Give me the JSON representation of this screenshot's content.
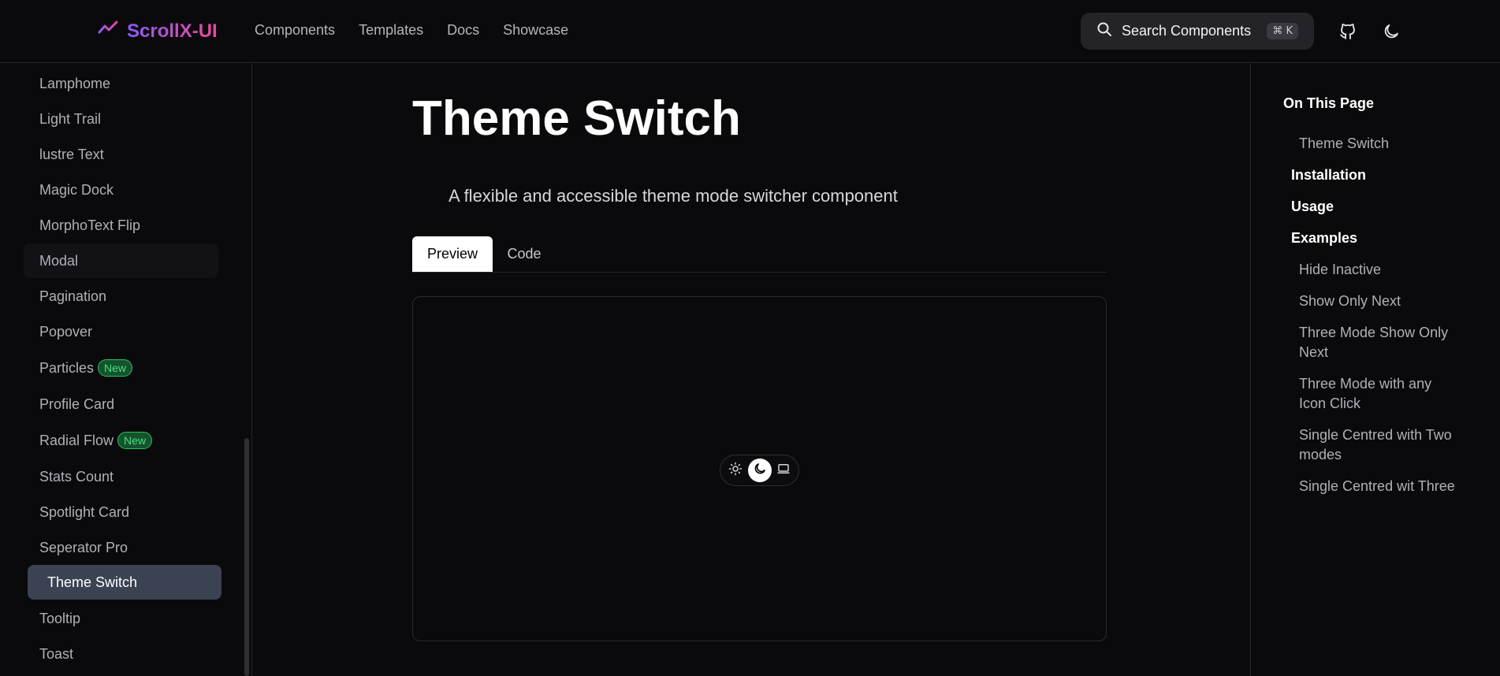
{
  "header": {
    "logo_text": "ScrollX-UI",
    "nav": [
      "Components",
      "Templates",
      "Docs",
      "Showcase"
    ],
    "search_label": "Search Components",
    "search_shortcut": "⌘ K",
    "icons": [
      "logo-chart-icon",
      "search-icon",
      "github-icon",
      "moon-icon"
    ]
  },
  "sidebar": {
    "items": [
      {
        "label": "Lamphome"
      },
      {
        "label": "Light Trail"
      },
      {
        "label": "lustre Text"
      },
      {
        "label": "Magic Dock"
      },
      {
        "label": "MorphoText Flip"
      },
      {
        "label": "Modal"
      },
      {
        "label": "Pagination"
      },
      {
        "label": "Popover"
      },
      {
        "label": "Particles",
        "badge": "New"
      },
      {
        "label": "Profile Card"
      },
      {
        "label": "Radial Flow",
        "badge": "New"
      },
      {
        "label": "Stats Count"
      },
      {
        "label": "Spotlight Card"
      },
      {
        "label": "Seperator Pro"
      },
      {
        "label": "Theme Switch"
      },
      {
        "label": "Tooltip"
      },
      {
        "label": "Toast"
      }
    ],
    "active": "Theme Switch"
  },
  "main": {
    "title": "Theme Switch",
    "description": "A flexible and accessible theme mode switcher component",
    "tabs": [
      "Preview",
      "Code"
    ],
    "active_tab": "Preview",
    "switcher": {
      "modes": [
        "sun-icon",
        "moon-icon",
        "laptop-icon"
      ],
      "selected": "moon-icon"
    }
  },
  "toc": {
    "heading": "On This Page",
    "items": [
      {
        "label": "Theme Switch",
        "level": 2
      },
      {
        "label": "Installation",
        "level": 1
      },
      {
        "label": "Usage",
        "level": 1
      },
      {
        "label": "Examples",
        "level": 1
      },
      {
        "label": "Hide Inactive",
        "level": 2
      },
      {
        "label": "Show Only Next",
        "level": 2
      },
      {
        "label": "Three Mode Show Only Next",
        "level": 2
      },
      {
        "label": "Three Mode with any Icon Click",
        "level": 2
      },
      {
        "label": "Single Centred with Two modes",
        "level": 2
      },
      {
        "label": "Single Centred wit Three",
        "level": 2
      }
    ]
  },
  "colors": {
    "background": "#0a0a0c",
    "active_item": "#3b4252",
    "badge_green": "#4ade80",
    "brand_from": "#8b5cf6",
    "brand_to": "#ec4899"
  }
}
